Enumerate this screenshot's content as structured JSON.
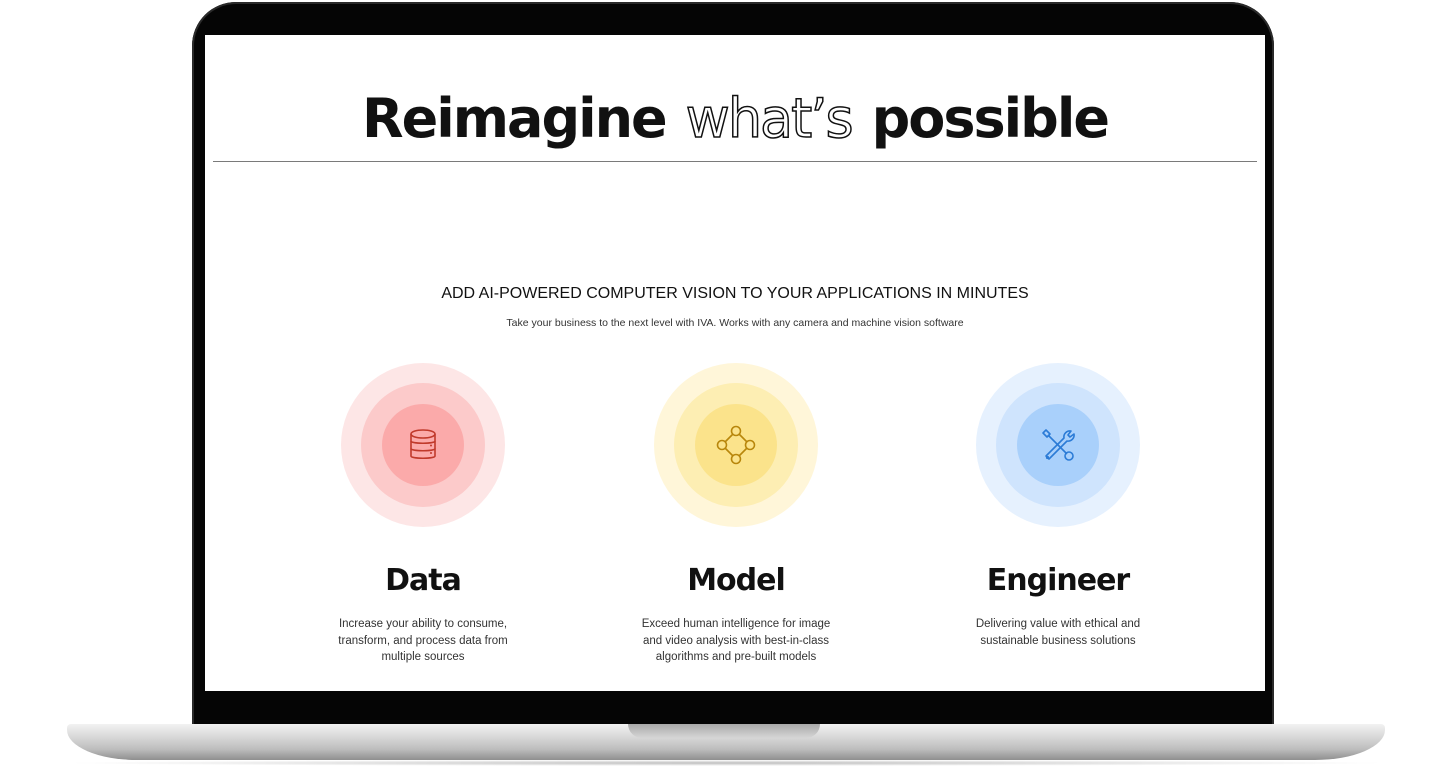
{
  "hero": {
    "word1": "Reimagine",
    "word2": "what’s",
    "word3": "possible"
  },
  "headline": "ADD AI-POWERED COMPUTER VISION TO YOUR APPLICATIONS IN MINUTES",
  "subline": "Take your business to the next level with IVA. Works with any camera and machine vision software",
  "features": [
    {
      "title": "Data",
      "description": "Increase your ability to consume, transform, and process data from multiple sources",
      "icon": "database-icon",
      "colors": [
        "#fde6e6",
        "#fccaca",
        "#fbaaaa",
        "#c0392b"
      ]
    },
    {
      "title": "Model",
      "description": "Exceed human intelligence for image and video analysis with best-in-class algorithms and pre-built models",
      "icon": "network-nodes-icon",
      "colors": [
        "#fff6d9",
        "#fdeeb3",
        "#fbe38b",
        "#b8860b"
      ]
    },
    {
      "title": "Engineer",
      "description": "Delivering value with ethical and sustainable business solutions",
      "icon": "wrench-tools-icon",
      "colors": [
        "#e6f1fe",
        "#cfe4fd",
        "#a9d0fb",
        "#2b7bd6"
      ]
    }
  ]
}
